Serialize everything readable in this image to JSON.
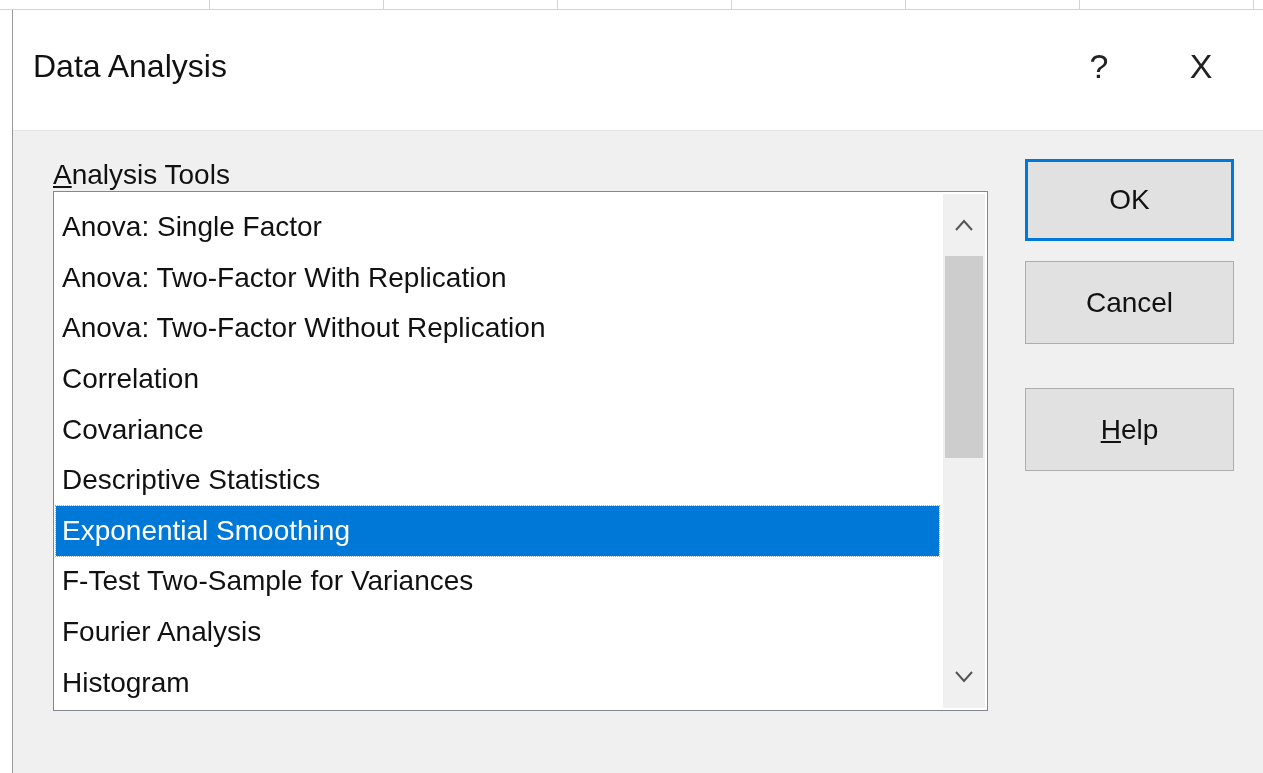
{
  "window": {
    "title": "Data Analysis",
    "help_glyph": "?",
    "close_glyph": "X"
  },
  "analysis_tools": {
    "mnemonic": "A",
    "label_rest": "nalysis Tools",
    "items": [
      {
        "label": "Anova: Single Factor",
        "selected": false
      },
      {
        "label": "Anova: Two-Factor With Replication",
        "selected": false
      },
      {
        "label": "Anova: Two-Factor Without Replication",
        "selected": false
      },
      {
        "label": "Correlation",
        "selected": false
      },
      {
        "label": "Covariance",
        "selected": false
      },
      {
        "label": "Descriptive Statistics",
        "selected": false
      },
      {
        "label": "Exponential Smoothing",
        "selected": true
      },
      {
        "label": "F-Test Two-Sample for Variances",
        "selected": false
      },
      {
        "label": "Fourier Analysis",
        "selected": false
      },
      {
        "label": "Histogram",
        "selected": false
      }
    ]
  },
  "buttons": [
    {
      "label_rest": "OK",
      "default": true
    },
    {
      "label_rest": "Cancel",
      "default": false
    },
    {
      "mnemonic": "H",
      "label_rest": "elp",
      "default": false
    }
  ]
}
